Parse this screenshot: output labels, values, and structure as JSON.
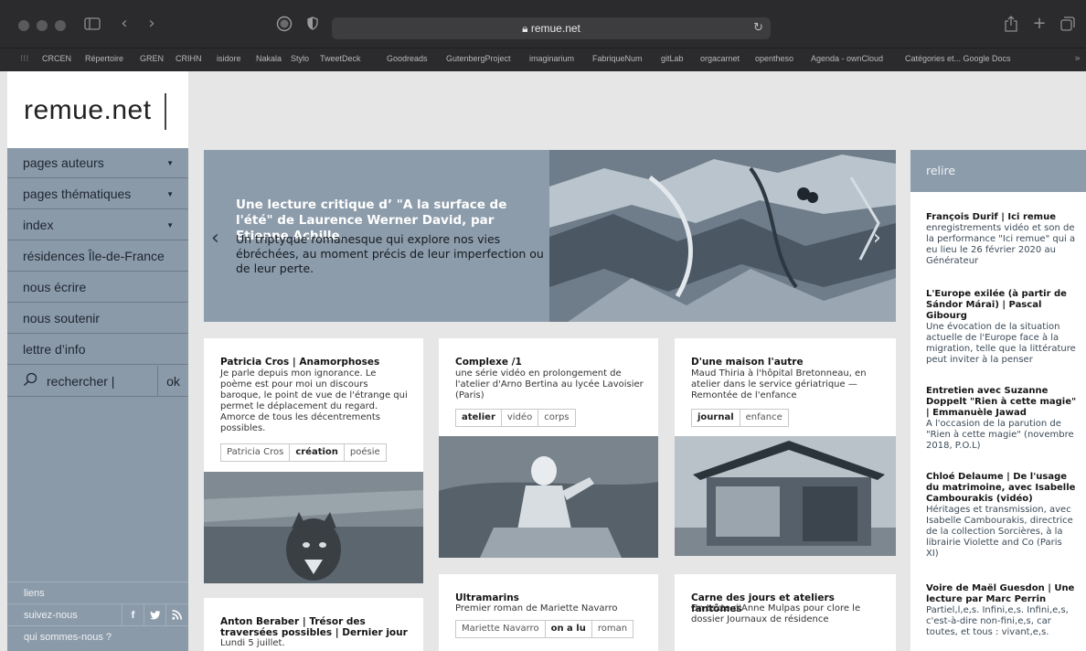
{
  "browser": {
    "url": "remue.net",
    "bookmarks": [
      "CRCEN",
      "Répertoire",
      "GREN",
      "CRIHN",
      "isidore",
      "Nakala",
      "Stylo",
      "TweetDeck",
      "Goodreads",
      "GutenbergProject",
      "imaginarium",
      "FabriqueNum",
      "gitLab",
      "orgacarnet",
      "opentheso",
      "Agenda - ownCloud",
      "Catégories et... Google Docs"
    ],
    "icons": [
      "sidebar-icon",
      "back-icon",
      "forward-icon",
      "lock-icon",
      "reload-icon",
      "share-icon",
      "new-tab-icon",
      "tabs-icon"
    ]
  },
  "site": {
    "logo": "remue.net",
    "nav": [
      {
        "label": "pages auteurs",
        "dropdown": true
      },
      {
        "label": "pages thématiques",
        "dropdown": true
      },
      {
        "label": "index",
        "dropdown": true
      },
      {
        "label": "résidences Île-de-France",
        "dropdown": false
      },
      {
        "label": "nous écrire",
        "dropdown": false
      },
      {
        "label": "nous soutenir",
        "dropdown": false
      },
      {
        "label": "lettre d’info",
        "dropdown": false
      }
    ],
    "search": {
      "label": "rechercher |",
      "ok": "ok"
    },
    "footer": {
      "links": "liens",
      "follow": "suivez-nous",
      "about": "qui sommes-nous ?",
      "social": [
        "f",
        "t",
        "rss"
      ]
    }
  },
  "hero": {
    "title": "Une lecture critique d’ \"A la surface de l'été\" de Laurence Werner David, par Etienne Achille.",
    "subtitle": "Un triptyque romanesque qui explore nos vies ébréchées, au moment précis de leur imperfection ou de leur perte.",
    "prev": "‹",
    "next": "›"
  },
  "cards": [
    {
      "title": "Patricia Cros | Anamorphoses",
      "desc": "Je parle depuis mon ignorance. Le poème est pour moi un discours baroque, le point de vue de l'étrange qui permet le déplacement du regard. Amorce de tous les décentrements possibles.",
      "tags": [
        "Patricia Cros",
        "création",
        "poésie"
      ]
    },
    {
      "title": "Complexe /1",
      "desc": "une série vidéo en prolongement de l'atelier d'Arno Bertina au lycée Lavoisier (Paris)",
      "tags": [
        "atelier",
        "vidéo",
        "corps"
      ]
    },
    {
      "title": "D'une maison l'autre",
      "desc": "Maud Thiria à l'hôpital Bretonneau, en atelier dans le service gériatrique — Remontée de l'enfance",
      "tags": [
        "journal",
        "enfance"
      ]
    },
    {
      "title": "Anton Beraber | Trésor des traversées possibles | Dernier jour",
      "desc": "Lundi 5 juillet.",
      "tags": []
    },
    {
      "title": "Ultramarins",
      "desc": "Premier roman de Mariette Navarro",
      "tags": [
        "Mariette Navarro",
        "on a lu",
        "roman"
      ]
    },
    {
      "title": "Carne des jours et ateliers fantômes",
      "desc": "Un texte d'Anne Mulpas pour clore le dossier Journaux de résidence",
      "tags": []
    }
  ],
  "relire": {
    "heading": "relire",
    "items": [
      {
        "title": "François Durif | Ici remue",
        "desc": "enregistrements vidéo et son de la performance \"Ici remue\" qui a eu lieu le 26 février 2020 au Générateur"
      },
      {
        "title": "L'Europe exilée (à partir de Sándor Márai) | Pascal Gibourg",
        "desc": "Une évocation de la situation actuelle de l'Europe face à la migration, telle que la littérature peut inviter à la penser"
      },
      {
        "title": "Entretien avec Suzanne Doppelt \"Rien à cette magie\" | Emmanuèle Jawad",
        "desc": "A l'occasion de la parution de \"Rien à cette magie\" (novembre 2018, P.O.L)"
      },
      {
        "title": "Chloé Delaume | De l'usage du matrimoine, avec Isabelle Cambourakis (vidéo)",
        "desc": "Héritages et transmission, avec Isabelle Cambourakis, directrice de la collection Sorcières, à la librairie Violette and Co (Paris XI)"
      },
      {
        "title": "Voire de Maël Guesdon | Une lecture par Marc Perrin",
        "desc": "Partiel,l,e,s. Infini,e,s. Infini,e,s, c'est-à-dire non-fini,e,s, car toutes, et tous : vivant,e,s."
      }
    ]
  }
}
